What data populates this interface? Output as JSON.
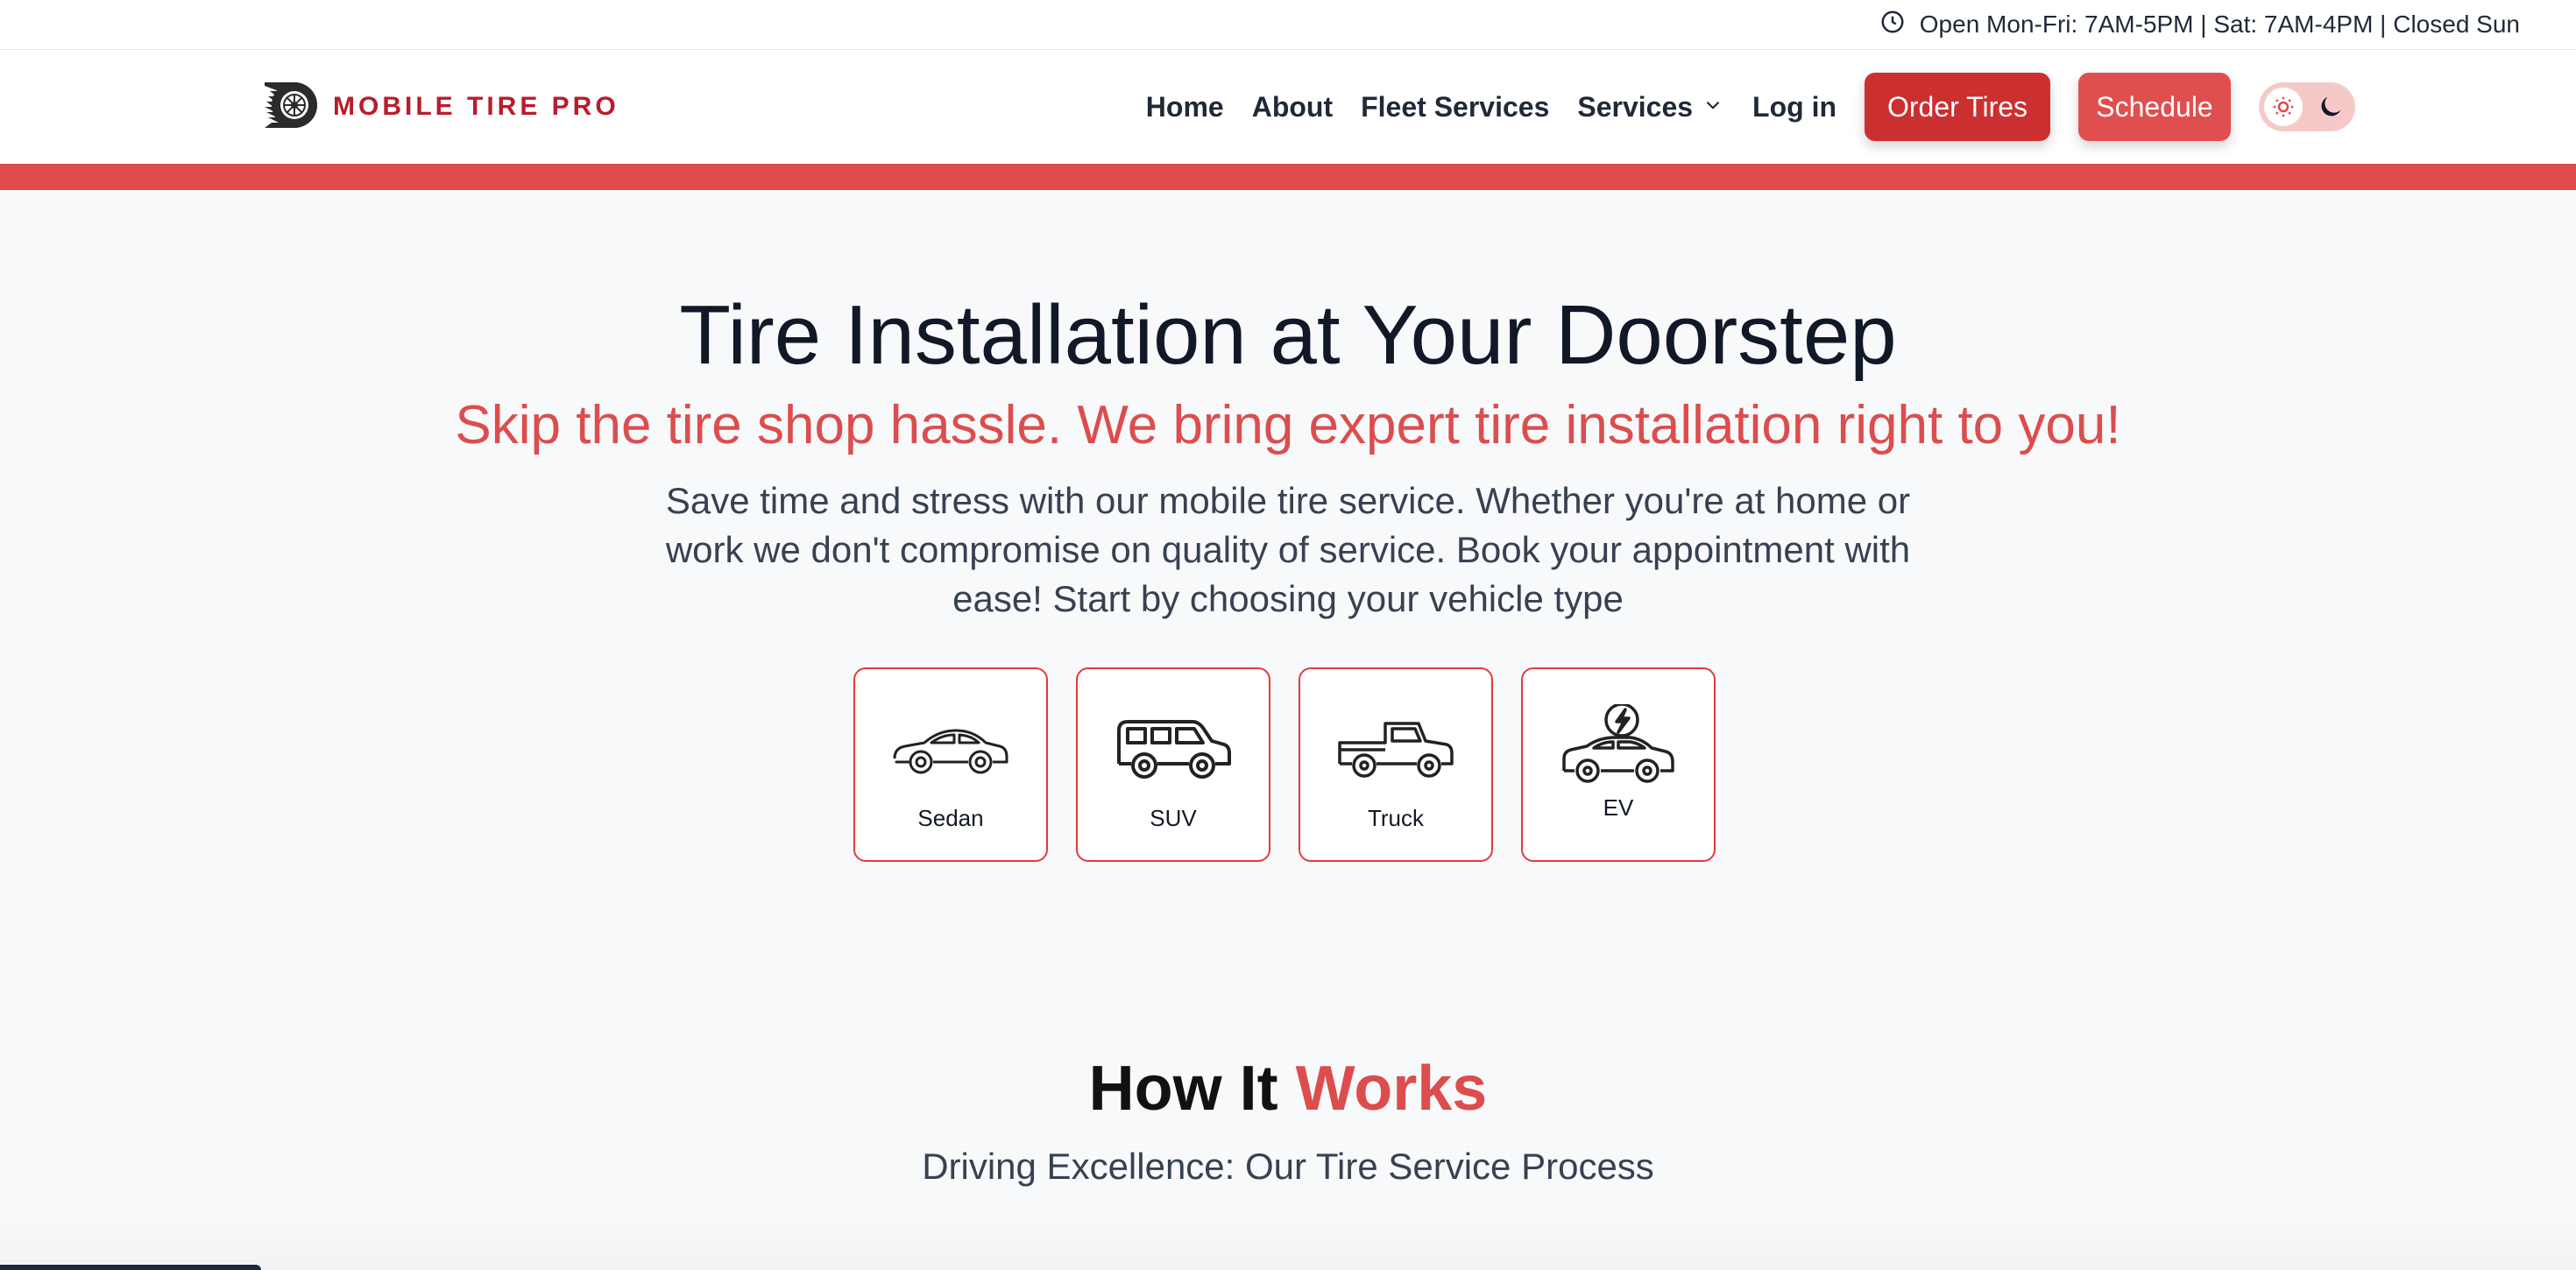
{
  "topbar": {
    "hours_icon": "clock-icon",
    "hours_text": "Open Mon-Fri: 7AM-5PM | Sat: 7AM-4PM | Closed Sun"
  },
  "header": {
    "logo_icon": "tire-logo-icon",
    "logo_text": "MOBILE TIRE PRO",
    "nav": {
      "home": "Home",
      "about": "About",
      "fleet": "Fleet Services",
      "services": "Services",
      "login": "Log in"
    },
    "order_label": "Order Tires",
    "schedule_label": "Schedule",
    "theme_icons": [
      "sun-icon",
      "moon-icon"
    ]
  },
  "hero": {
    "title": "Tire Installation at Your Doorstep",
    "subtitle": "Skip the tire shop hassle. We bring expert tire installation right to you!",
    "description": "Save time and stress with our mobile tire service. Whether you're at home or work we don't compromise on quality of service. Book your appointment with ease! Start by choosing your vehicle type"
  },
  "vehicles": [
    {
      "label": "Sedan",
      "icon": "sedan-icon"
    },
    {
      "label": "SUV",
      "icon": "suv-icon"
    },
    {
      "label": "Truck",
      "icon": "truck-icon"
    },
    {
      "label": "EV",
      "icon": "ev-icon"
    }
  ],
  "how": {
    "title_plain": "How It",
    "title_accent": "Works",
    "subtitle": "Driving Excellence: Our Tire Service Process"
  },
  "colors": {
    "accent": "#dc4d4d",
    "order_button": "#cc2f2f",
    "schedule_button": "#df4f4f",
    "logo_text": "#b91c2c"
  }
}
